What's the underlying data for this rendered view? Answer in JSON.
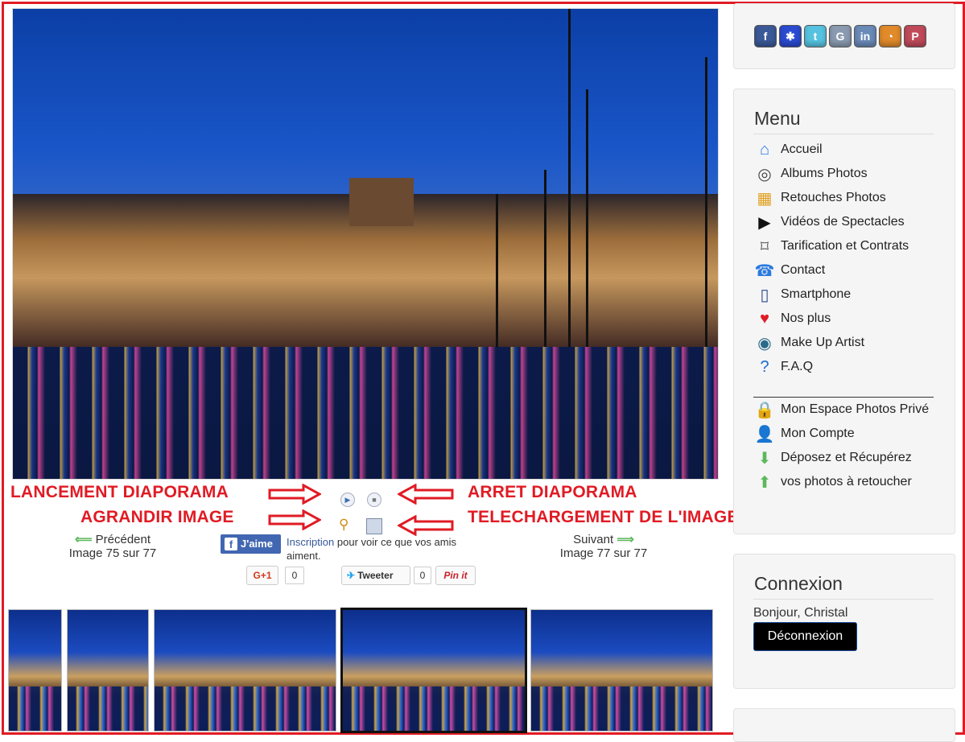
{
  "annotations": {
    "start_slideshow": "LANCEMENT DIAPORAMA",
    "stop_slideshow": "ARRET DIAPORAMA",
    "enlarge_image": "AGRANDIR IMAGE",
    "download_image": "TELECHARGEMENT DE L'IMAGE"
  },
  "navigation": {
    "previous_label": "Précédent",
    "previous_count": "Image 75 sur 77",
    "next_label": "Suivant",
    "next_count": "Image 77 sur 77"
  },
  "social_share": {
    "fb_like": "J'aime",
    "fb_signup_link": "Inscription",
    "fb_signup_text": "pour voir ce que vos amis aiment.",
    "gplus_label": "G+1",
    "gplus_count": "0",
    "tweet_label": "Tweeter",
    "tweet_count": "0",
    "pinit_label": "Pin it"
  },
  "sidebar": {
    "social_icons": [
      {
        "name": "facebook-icon",
        "glyph": "f",
        "color": "#3b5998"
      },
      {
        "name": "myspace-icon",
        "glyph": "✱",
        "color": "#2a4ad0"
      },
      {
        "name": "twitter-icon",
        "glyph": "t",
        "color": "#55c3e0"
      },
      {
        "name": "google-icon",
        "glyph": "G",
        "color": "#8a9ab0"
      },
      {
        "name": "linkedin-icon",
        "glyph": "in",
        "color": "#6a8ab8"
      },
      {
        "name": "rss-icon",
        "glyph": "◔",
        "color": "#e08a2a"
      },
      {
        "name": "pinterest-icon",
        "glyph": "P",
        "color": "#c04a5a"
      }
    ],
    "menu_title": "Menu",
    "menu_items": [
      {
        "label": "Accueil",
        "icon": "home-icon",
        "glyph": "⌂",
        "color": "#2a7ae0"
      },
      {
        "label": "Albums Photos",
        "icon": "camera-icon",
        "glyph": "◎",
        "color": "#444"
      },
      {
        "label": "Retouches Photos",
        "icon": "photo-edit-icon",
        "glyph": "▦",
        "color": "#e0a020"
      },
      {
        "label": "Vidéos de Spectacles",
        "icon": "video-icon",
        "glyph": "▶",
        "color": "#111"
      },
      {
        "label": "Tarification et Contrats",
        "icon": "price-tag-icon",
        "glyph": "⌑",
        "color": "#555"
      },
      {
        "label": "Contact",
        "icon": "phone-icon",
        "glyph": "☎",
        "color": "#2a7ae0"
      },
      {
        "label": "Smartphone",
        "icon": "smartphone-icon",
        "glyph": "▯",
        "color": "#2a4a8a"
      },
      {
        "label": "Nos plus",
        "icon": "heart-icon",
        "glyph": "♥",
        "color": "#e01b24"
      },
      {
        "label": "Make Up Artist",
        "icon": "eye-icon",
        "glyph": "◉",
        "color": "#2a6a8a"
      },
      {
        "label": "F.A.Q",
        "icon": "help-icon",
        "glyph": "?",
        "color": "#1a6ad0"
      }
    ],
    "private_items": [
      {
        "label": "Mon Espace Photos Privé",
        "icon": "lock-icon",
        "glyph": "🔒",
        "color": "#d0a000"
      },
      {
        "label": "Mon Compte",
        "icon": "user-icon",
        "glyph": "👤",
        "color": "#2a7ae0"
      },
      {
        "label": "Déposez et Récupérez",
        "icon": "download-arrow-icon",
        "glyph": "⬇",
        "color": "#5cb85c"
      },
      {
        "label": "vos photos à retoucher",
        "icon": "upload-arrow-icon",
        "glyph": "⬆",
        "color": "#5cb85c"
      }
    ],
    "login_title": "Connexion",
    "greeting": "Bonjour, Christal",
    "logout_label": "Déconnexion"
  },
  "colors": {
    "annotation_red": "#e01b24",
    "facebook_blue": "#4267b2"
  }
}
